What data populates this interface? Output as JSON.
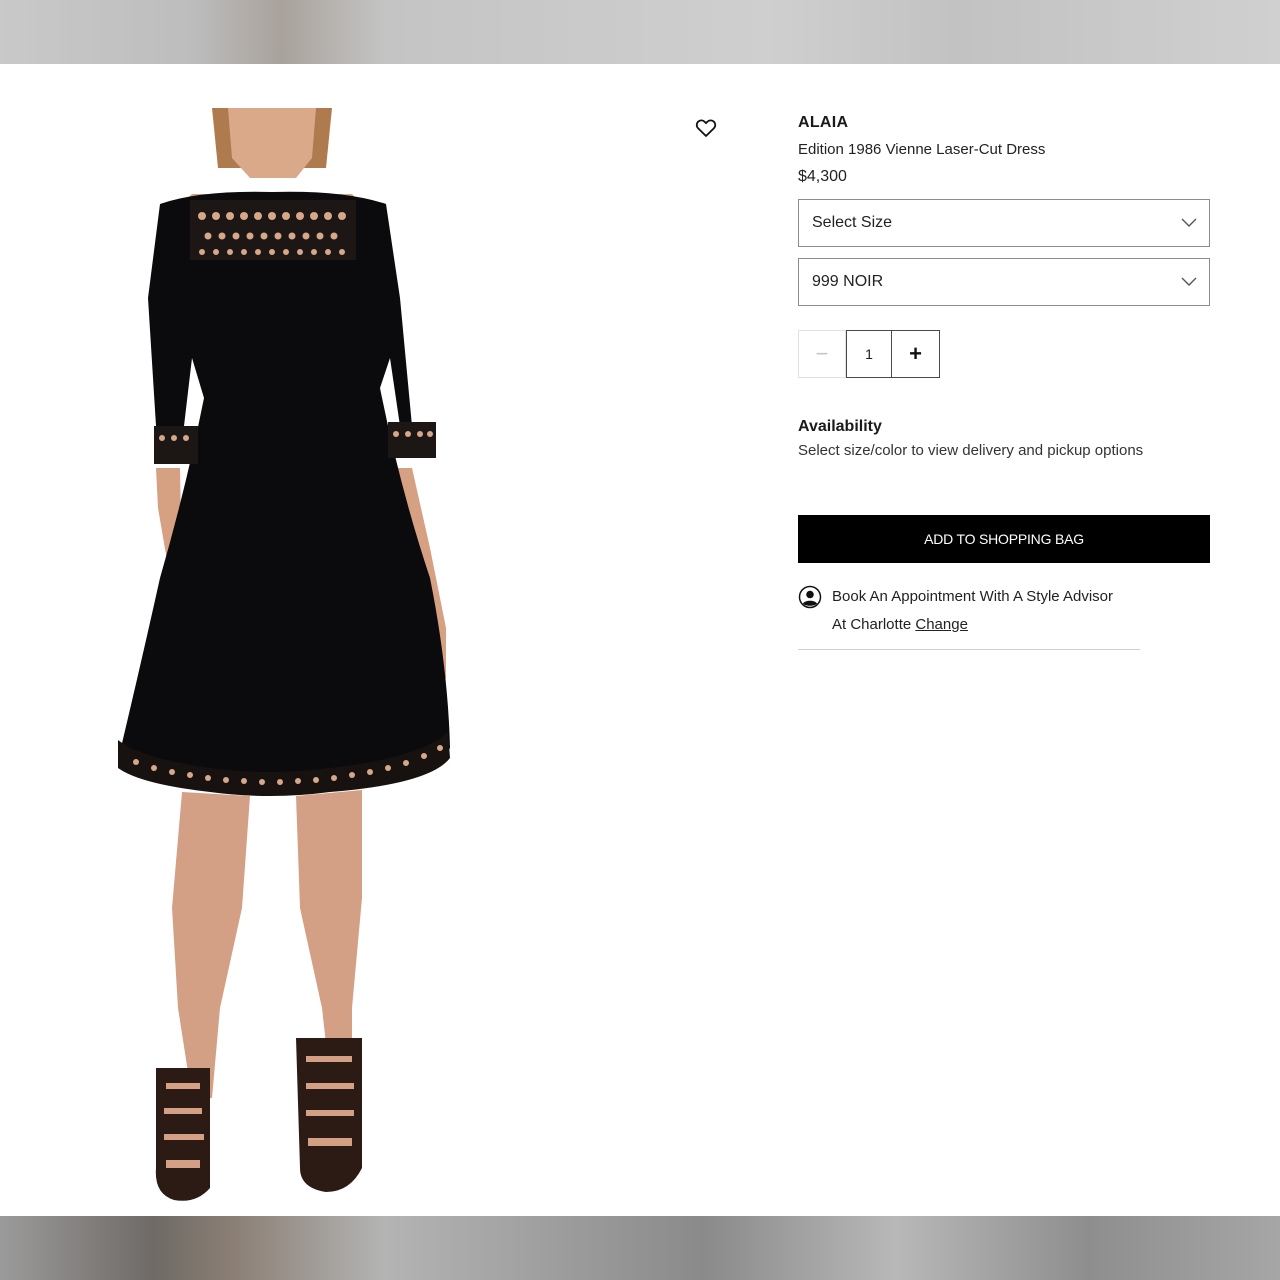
{
  "product": {
    "brand": "ALAIA",
    "name": "Edition 1986 Vienne Laser-Cut Dress",
    "price": "$4,300"
  },
  "options": {
    "size_selected": "Select Size",
    "color_selected": "999 NOIR"
  },
  "quantity": {
    "value": "1",
    "minus_label": "−",
    "plus_label": "+"
  },
  "availability": {
    "title": "Availability",
    "text": "Select size/color to view delivery and pickup options"
  },
  "cart": {
    "add_label": "ADD TO SHOPPING BAG"
  },
  "appointment": {
    "line1": "Book An Appointment With A Style Advisor",
    "line2_prefix": "At Charlotte ",
    "change_label": "Change"
  },
  "icons": {
    "wishlist": "heart-icon",
    "dropdown": "chevron-down-icon",
    "appointment": "user-circle-icon"
  },
  "colors": {
    "button_bg": "#000000",
    "dress": "#0b0b0d"
  }
}
